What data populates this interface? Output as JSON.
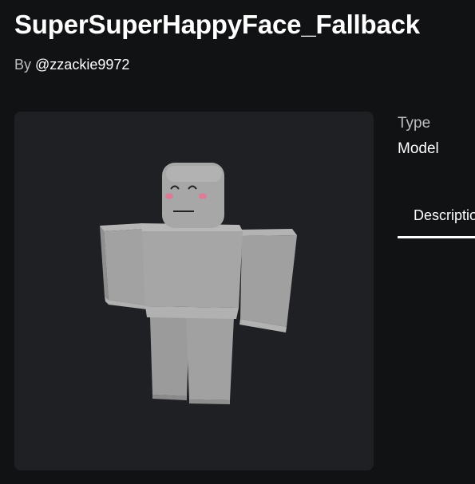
{
  "asset": {
    "title": "SuperSuperHappyFace_Fallback",
    "by_prefix": "By",
    "creator": "@zzackie9972"
  },
  "details": {
    "type_label": "Type",
    "type_value": "Model"
  },
  "tabs": [
    {
      "label": "Description",
      "active": true
    }
  ],
  "colors": {
    "background": "#111214",
    "viewer_background": "#1f2024",
    "text_primary": "#ffffff",
    "text_secondary": "#bdbec0",
    "avatar_gray": "#a3a3a3",
    "blush": "#e8728f"
  },
  "viewer": {
    "content": "3d-avatar-preview"
  }
}
